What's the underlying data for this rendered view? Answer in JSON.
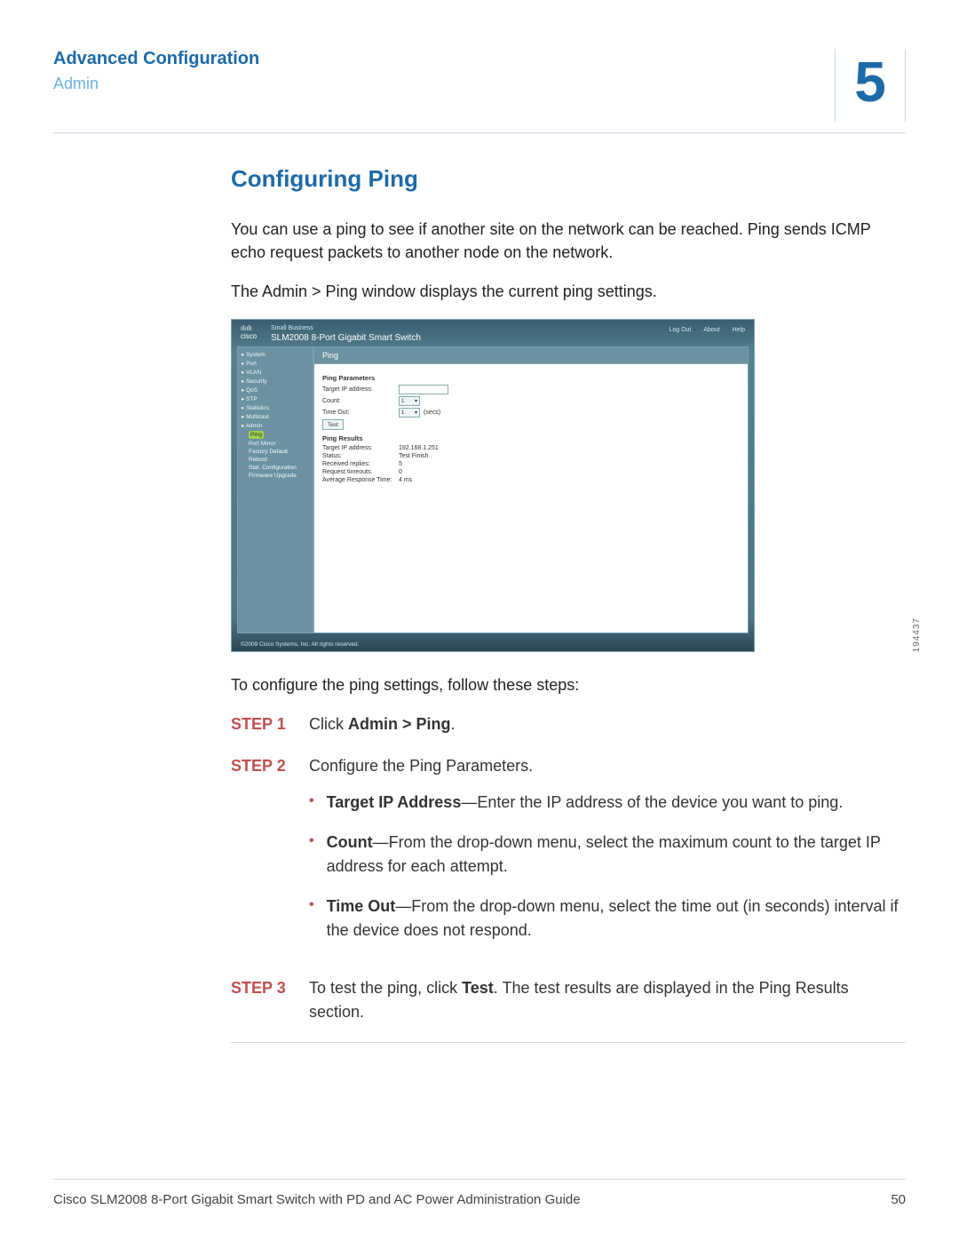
{
  "header": {
    "title": "Advanced Configuration",
    "subtitle": "Admin",
    "chapter_number": "5"
  },
  "section": {
    "title": "Configuring Ping",
    "intro_para_1": "You can use a ping to see if another site on the network can be reached. Ping sends ICMP echo request packets to another node on the network.",
    "intro_para_2": "The Admin > Ping window displays the current ping settings.",
    "followup": "To configure the ping settings, follow these steps:"
  },
  "screenshot": {
    "brand": "cisco",
    "brand_sub": "Small Business",
    "product": "SLM2008 8-Port Gigabit Smart Switch",
    "header_links": [
      "Log Out",
      "About",
      "Help"
    ],
    "side_items": [
      "▸ System",
      "▸ Port",
      "▸ VLAN",
      "▸ Security",
      "▸ QoS",
      "▸ STP",
      "▸ Statistics",
      "▸ Multicast"
    ],
    "side_admin": "▸ Admin",
    "side_sub": [
      "Ping",
      "Port Mirror",
      "Factory Default",
      "Reboot",
      "Stat. Configuration",
      "Firmware Upgrade"
    ],
    "side_selected": "Ping",
    "tab": "Ping",
    "params_title": "Ping Parameters",
    "param_target": "Target IP address:",
    "param_count": "Count:",
    "param_count_val": "1",
    "param_timeout": "Time Out:",
    "param_timeout_val": "1",
    "param_timeout_unit": "(secs)",
    "test_btn": "Test",
    "results_title": "Ping Results",
    "result_rows": [
      [
        "Target IP address:",
        "192.168.1.251"
      ],
      [
        "Status:",
        "Test Finish"
      ],
      [
        "Received replies:",
        "5"
      ],
      [
        "Request timeouts:",
        "0"
      ],
      [
        "Average Response Time:",
        "4 ms"
      ]
    ],
    "copyright": "©2009 Cisco Systems, Inc. All rights reserved.",
    "figure_id": "194437"
  },
  "steps": {
    "step1_label": "STEP 1",
    "step1_a": "Click ",
    "step1_b": "Admin > Ping",
    "step1_c": ".",
    "step2_label": "STEP 2",
    "step2_text": "Configure the Ping Parameters.",
    "b1_bold": "Target IP Address",
    "b1_rest": "—Enter the IP address of the device you want to ping.",
    "b2_bold": "Count",
    "b2_rest": "—From the drop-down menu, select the maximum count to the target IP address for each attempt.",
    "b3_bold": "Time Out",
    "b3_rest": "—From the drop-down menu, select the time out (in seconds) interval if the device does not respond.",
    "step3_label": "STEP 3",
    "step3_a": "To test the ping, click ",
    "step3_b": "Test",
    "step3_c": ". The test results are displayed in the Ping Results section."
  },
  "footer": {
    "doc_title": "Cisco SLM2008 8-Port Gigabit Smart Switch with PD and AC Power Administration Guide",
    "page_number": "50"
  }
}
